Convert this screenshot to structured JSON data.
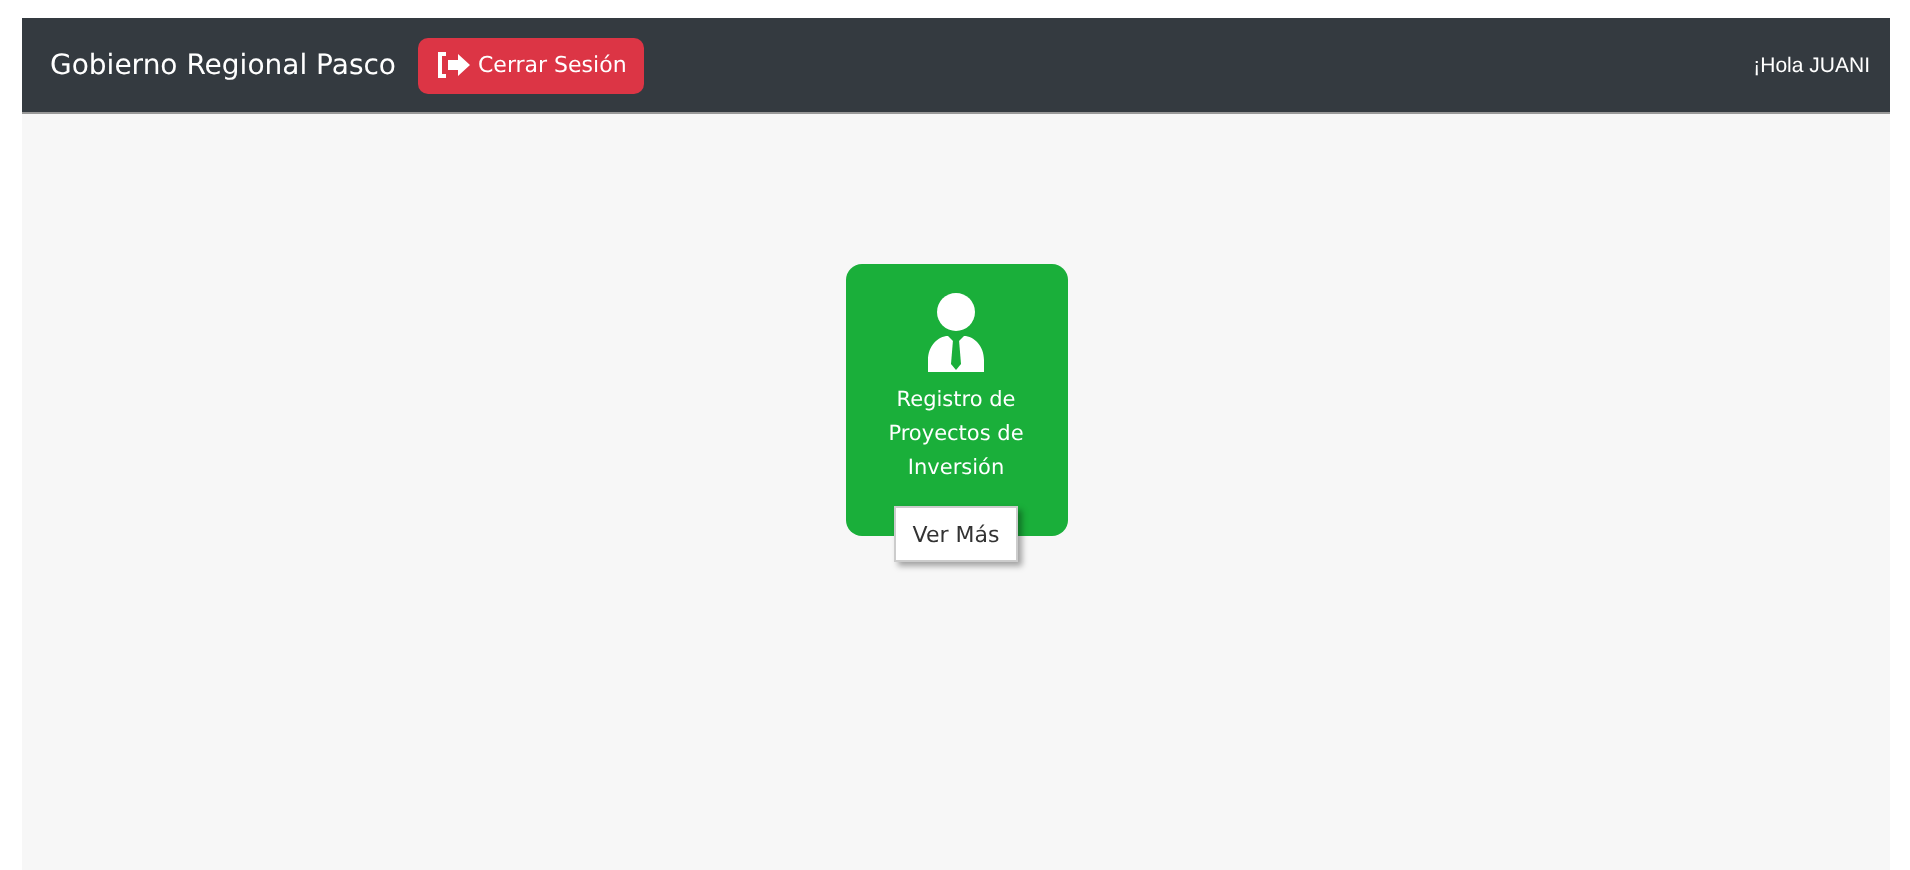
{
  "navbar": {
    "brand": "Gobierno Regional Pasco",
    "logout_button": "Cerrar Sesión",
    "greeting": "¡Hola JUANI"
  },
  "cards": [
    {
      "title": "Registro de Proyectos de Inversión",
      "button": "Ver Más"
    }
  ]
}
